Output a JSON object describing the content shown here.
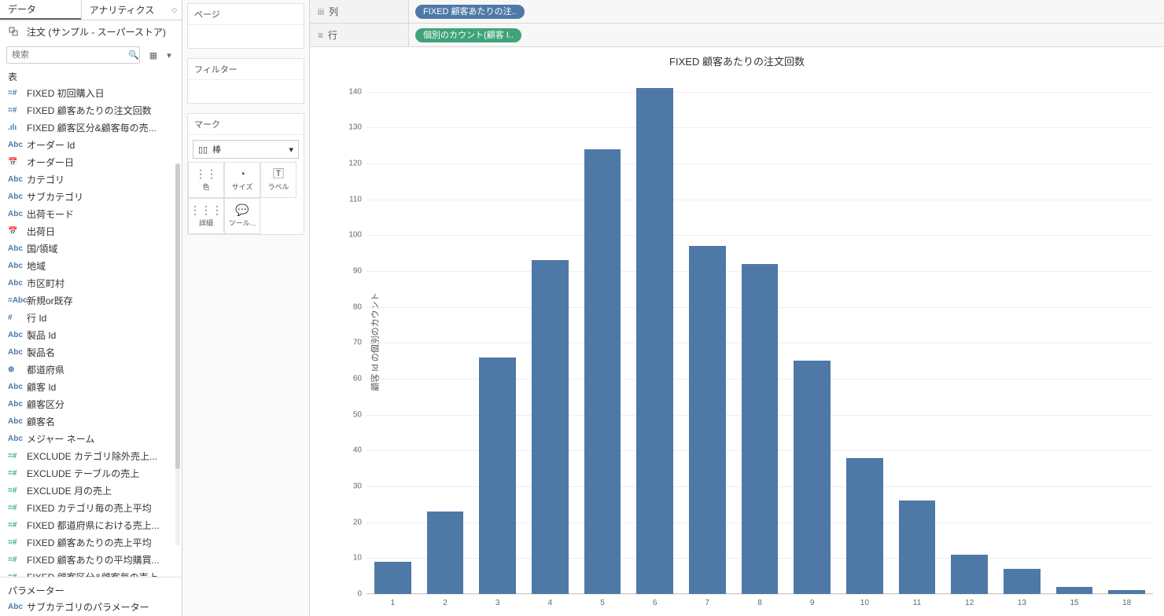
{
  "data_pane": {
    "tab_data": "データ",
    "tab_analytics": "アナリティクス",
    "datasource": "注文 (サンプル - スーパーストア)",
    "search_placeholder": "検索",
    "tables_header": "表",
    "params_header": "パラメーター",
    "fields": [
      {
        "icon": "=#",
        "cls": "calc",
        "label": "FIXED 初回購入日"
      },
      {
        "icon": "=#",
        "cls": "calc",
        "label": "FIXED 顧客あたりの注文回数"
      },
      {
        "icon": ".ılı",
        "cls": "dim",
        "label": "FIXED 顧客区分&顧客毎の売..."
      },
      {
        "icon": "Abc",
        "cls": "dim",
        "label": "オーダー Id"
      },
      {
        "icon": "📅",
        "cls": "dim",
        "label": "オーダー日"
      },
      {
        "icon": "Abc",
        "cls": "dim",
        "label": "カテゴリ"
      },
      {
        "icon": "Abc",
        "cls": "dim",
        "label": "サブカテゴリ"
      },
      {
        "icon": "Abc",
        "cls": "dim",
        "label": "出荷モード"
      },
      {
        "icon": "📅",
        "cls": "dim",
        "label": "出荷日"
      },
      {
        "icon": "Abc",
        "cls": "dim",
        "label": "国/領域"
      },
      {
        "icon": "Abc",
        "cls": "dim",
        "label": "地域"
      },
      {
        "icon": "Abc",
        "cls": "dim",
        "label": "市区町村"
      },
      {
        "icon": "=Abc",
        "cls": "calc",
        "label": "新規or既存"
      },
      {
        "icon": "#",
        "cls": "dim",
        "label": "行 Id"
      },
      {
        "icon": "Abc",
        "cls": "dim",
        "label": "製品 Id"
      },
      {
        "icon": "Abc",
        "cls": "dim",
        "label": "製品名"
      },
      {
        "icon": "⊕",
        "cls": "dim",
        "label": "都道府県"
      },
      {
        "icon": "Abc",
        "cls": "dim",
        "label": "顧客 Id"
      },
      {
        "icon": "Abc",
        "cls": "dim",
        "label": "顧客区分"
      },
      {
        "icon": "Abc",
        "cls": "dim",
        "label": "顧客名"
      },
      {
        "icon": "Abc",
        "cls": "dim",
        "label": "メジャー ネーム"
      },
      {
        "icon": "=#",
        "cls": "meas",
        "label": "EXCLUDE カテゴリ除外売上..."
      },
      {
        "icon": "=#",
        "cls": "meas",
        "label": "EXCLUDE テーブルの売上"
      },
      {
        "icon": "=#",
        "cls": "meas",
        "label": "EXCLUDE 月の売上"
      },
      {
        "icon": "=#",
        "cls": "meas",
        "label": "FIXED カテゴリ毎の売上平均"
      },
      {
        "icon": "=#",
        "cls": "meas",
        "label": "FIXED 都道府県における売上..."
      },
      {
        "icon": "=#",
        "cls": "meas",
        "label": "FIXED 顧客あたりの売上平均"
      },
      {
        "icon": "=#",
        "cls": "meas",
        "label": "FIXED 顧客あたりの平均購買..."
      },
      {
        "icon": "=#",
        "cls": "meas",
        "label": "FIXED 顧客区分&顧客毎の売上"
      }
    ],
    "param_field": {
      "icon": "Abc",
      "cls": "dim",
      "label": "サブカテゴリのパラメーター"
    }
  },
  "cards": {
    "pages": "ページ",
    "filters": "フィルター",
    "marks": "マーク",
    "mark_type": "棒",
    "color": "色",
    "size": "サイズ",
    "label": "ラベル",
    "detail": "詳細",
    "tooltip": "ツール..."
  },
  "shelves": {
    "columns_label": "列",
    "rows_label": "行",
    "col_pill": "FIXED 顧客あたりの注..",
    "row_pill": "個別のカウント(顧客 I.."
  },
  "chart_data": {
    "type": "bar",
    "title": "FIXED 顧客あたりの注文回数",
    "ylabel": "顧客 Id の個別のカウント",
    "xlabel": "",
    "categories": [
      "1",
      "2",
      "3",
      "4",
      "5",
      "6",
      "7",
      "8",
      "9",
      "10",
      "11",
      "12",
      "13",
      "15",
      "18"
    ],
    "values": [
      9,
      23,
      66,
      93,
      124,
      141,
      97,
      92,
      65,
      38,
      26,
      11,
      7,
      2,
      1
    ],
    "ylim": [
      0,
      145
    ],
    "yticks": [
      0,
      10,
      20,
      30,
      40,
      50,
      60,
      70,
      80,
      90,
      100,
      110,
      120,
      130,
      140
    ]
  }
}
